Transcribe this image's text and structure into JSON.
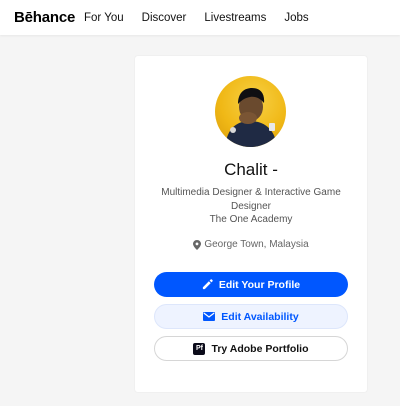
{
  "brand": {
    "logo": "Bēhance"
  },
  "nav": {
    "items": [
      "For You",
      "Discover",
      "Livestreams",
      "Jobs"
    ]
  },
  "profile": {
    "name": "Chalit -",
    "occupation": "Multimedia Designer & Interactive Game Designer",
    "school": "The One Academy",
    "location": "George Town, Malaysia"
  },
  "actions": {
    "edit_profile": "Edit Your Profile",
    "edit_availability": "Edit Availability",
    "try_portfolio": "Try Adobe Portfolio",
    "portfolio_badge": "Pf"
  },
  "colors": {
    "primary": "#0057ff",
    "secondary_bg": "#eef3ff",
    "avatar_bg": "#f0b816"
  },
  "icons": [
    "pencil-icon",
    "mail-icon",
    "location-pin-icon",
    "adobe-portfolio-icon"
  ]
}
